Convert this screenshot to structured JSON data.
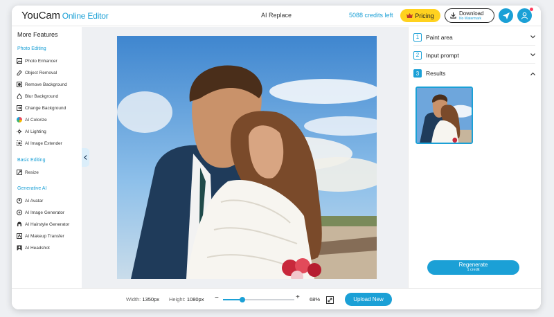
{
  "header": {
    "logo_main": "YouCam",
    "logo_sub": "Online Editor",
    "title": "AI Replace",
    "credits": "5088 credits left",
    "pricing_label": "Pricing",
    "download_label": "Download",
    "download_sub": "No Watermark"
  },
  "sidebar": {
    "title": "More Features",
    "sections": {
      "photo_editing": "Photo Editing",
      "basic_editing": "Basic Editing",
      "generative_ai": "Generative AI"
    },
    "items": [
      {
        "label": "Photo Enhancer",
        "icon": "photo-enhancer-icon"
      },
      {
        "label": "Object Removal",
        "icon": "object-removal-icon"
      },
      {
        "label": "Remove Background",
        "icon": "remove-background-icon"
      },
      {
        "label": "Blur Background",
        "icon": "blur-background-icon"
      },
      {
        "label": "Change Background",
        "icon": "change-background-icon"
      },
      {
        "label": "AI Colorize",
        "icon": "colorize-icon"
      },
      {
        "label": "AI Lighting",
        "icon": "lighting-icon"
      },
      {
        "label": "AI Image Extender",
        "icon": "image-extender-icon"
      },
      {
        "label": "Resize",
        "icon": "resize-icon"
      },
      {
        "label": "AI Avatar",
        "icon": "avatar-icon"
      },
      {
        "label": "AI Image Generator",
        "icon": "image-generator-icon"
      },
      {
        "label": "AI Hairstyle Generator",
        "icon": "hairstyle-icon"
      },
      {
        "label": "AI Makeup Transfer",
        "icon": "makeup-icon"
      },
      {
        "label": "AI Headshot",
        "icon": "headshot-icon"
      }
    ]
  },
  "panel": {
    "steps": [
      {
        "num": "1",
        "label": "Paint area"
      },
      {
        "num": "2",
        "label": "Input prompt"
      },
      {
        "num": "3",
        "label": "Results"
      }
    ],
    "regenerate_label": "Regenerate",
    "regenerate_sub": "1 credit"
  },
  "bottom": {
    "width_label": "Width:",
    "width_value": "1350px",
    "height_label": "Height:",
    "height_value": "1080px",
    "zoom_value": "68%",
    "zoom_fraction": 0.27,
    "upload_label": "Upload New"
  },
  "colors": {
    "accent": "#1ba0d6",
    "pricing": "#ffd21f",
    "canvas_bg": "#eef0f3"
  }
}
